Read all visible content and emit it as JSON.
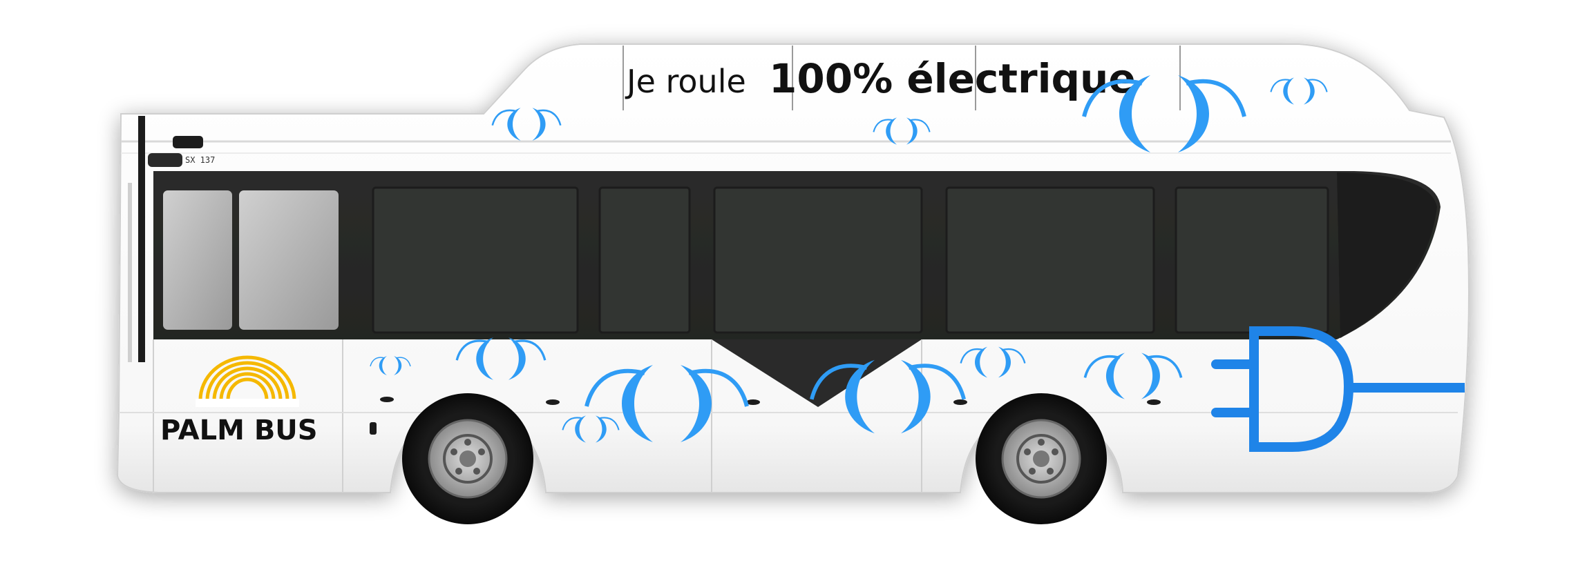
{
  "bus": {
    "slogan_prefix": "Je roule",
    "slogan_emphasis": "100% électrique",
    "logo_text": "PALM BUS",
    "plate_text": "SX 137"
  },
  "colors": {
    "body": "#ffffff",
    "window": "#2a2b29",
    "accent_blue": "#2f9cf5",
    "plug_blue": "#1f84e8",
    "logo_sun": "#f5b800",
    "text": "#111111"
  },
  "icons": {
    "swirl": "blue-swirl-icon",
    "plug": "electric-plug-icon",
    "sun": "sun-logo-icon"
  }
}
